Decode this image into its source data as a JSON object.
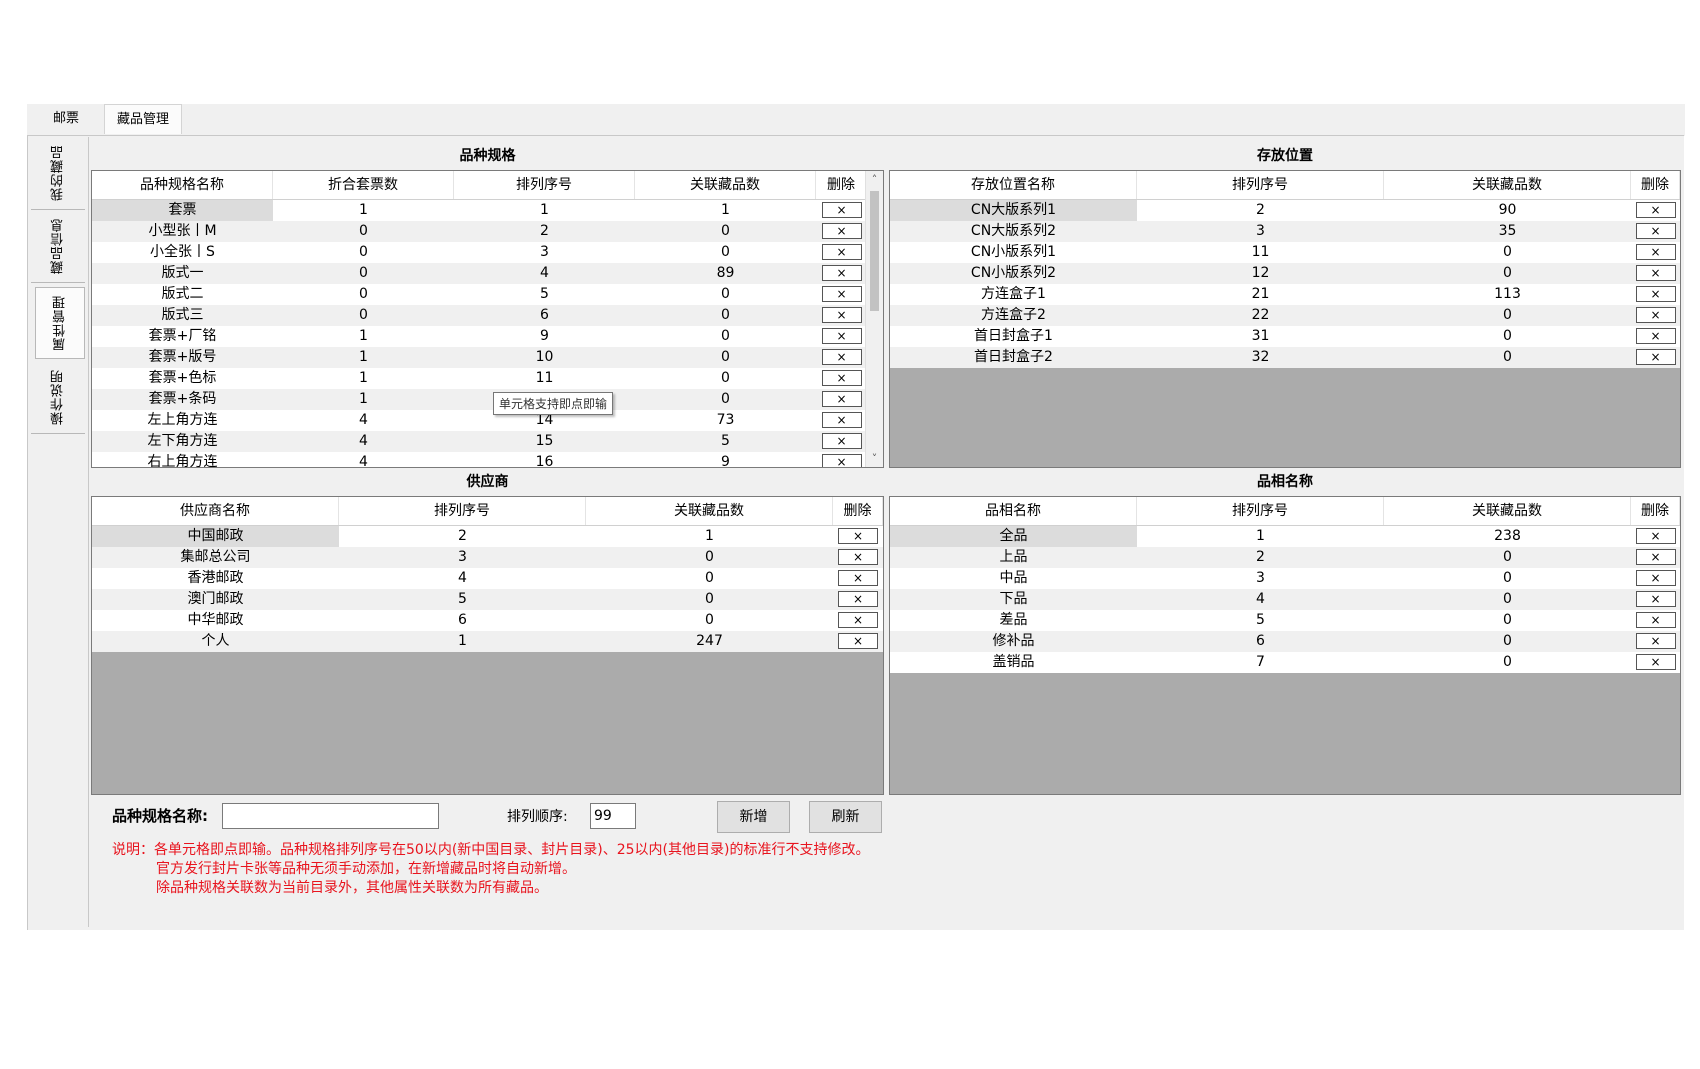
{
  "top_tabs": [
    {
      "label": "邮票"
    },
    {
      "label": "藏品管理"
    }
  ],
  "side_tabs": [
    {
      "label": "我的藏品"
    },
    {
      "label": "藏品信息"
    },
    {
      "label": "属性管理"
    },
    {
      "label": "操作说明"
    }
  ],
  "variety": {
    "title": "品种规格",
    "headers": [
      "品种规格名称",
      "折合套票数",
      "排列序号",
      "关联藏品数",
      "删除"
    ],
    "rows": [
      [
        "套票",
        "1",
        "1",
        "1"
      ],
      [
        "小型张丨M",
        "0",
        "2",
        "0"
      ],
      [
        "小全张丨S",
        "0",
        "3",
        "0"
      ],
      [
        "版式一",
        "0",
        "4",
        "89"
      ],
      [
        "版式二",
        "0",
        "5",
        "0"
      ],
      [
        "版式三",
        "0",
        "6",
        "0"
      ],
      [
        "套票+厂铭",
        "1",
        "9",
        "0"
      ],
      [
        "套票+版号",
        "1",
        "10",
        "0"
      ],
      [
        "套票+色标",
        "1",
        "11",
        "0"
      ],
      [
        "套票+条码",
        "1",
        "",
        "0"
      ],
      [
        "左上角方连",
        "4",
        "14",
        "73"
      ],
      [
        "左下角方连",
        "4",
        "15",
        "5"
      ],
      [
        "右上角方连",
        "4",
        "16",
        "9"
      ]
    ],
    "delete_glyph": "×",
    "tooltip": "单元格支持即点即输"
  },
  "storage": {
    "title": "存放位置",
    "headers": [
      "存放位置名称",
      "排列序号",
      "关联藏品数",
      "删除"
    ],
    "rows": [
      [
        "CN大版系列1",
        "2",
        "90"
      ],
      [
        "CN大版系列2",
        "3",
        "35"
      ],
      [
        "CN小版系列1",
        "11",
        "0"
      ],
      [
        "CN小版系列2",
        "12",
        "0"
      ],
      [
        "方连盒子1",
        "21",
        "113"
      ],
      [
        "方连盒子2",
        "22",
        "0"
      ],
      [
        "首日封盒子1",
        "31",
        "0"
      ],
      [
        "首日封盒子2",
        "32",
        "0"
      ]
    ]
  },
  "supplier": {
    "title": "供应商",
    "headers": [
      "供应商名称",
      "排列序号",
      "关联藏品数",
      "删除"
    ],
    "rows": [
      [
        "中国邮政",
        "2",
        "1"
      ],
      [
        "集邮总公司",
        "3",
        "0"
      ],
      [
        "香港邮政",
        "4",
        "0"
      ],
      [
        "澳门邮政",
        "5",
        "0"
      ],
      [
        "中华邮政",
        "6",
        "0"
      ],
      [
        "个人",
        "1",
        "247"
      ]
    ]
  },
  "condition": {
    "title": "品相名称",
    "headers": [
      "品相名称",
      "排列序号",
      "关联藏品数",
      "删除"
    ],
    "rows": [
      [
        "全品",
        "1",
        "238"
      ],
      [
        "上品",
        "2",
        "0"
      ],
      [
        "中品",
        "3",
        "0"
      ],
      [
        "下品",
        "4",
        "0"
      ],
      [
        "差品",
        "5",
        "0"
      ],
      [
        "修补品",
        "6",
        "0"
      ],
      [
        "盖销品",
        "7",
        "0"
      ]
    ]
  },
  "form": {
    "name_label": "品种规格名称:",
    "name_value": "",
    "order_label": "排列顺序:",
    "order_value": "99",
    "add_label": "新增",
    "refresh_label": "刷新"
  },
  "notes": [
    "说明：各单元格即点即输。品种规格排列序号在50以内(新中国目录、封片目录)、25以内(其他目录)的标准行不支持修改。",
    "官方发行封片卡张等品种无须手动添加，在新增藏品时将自动新增。",
    "除品种规格关联数为当前目录外，其他属性关联数为所有藏品。"
  ]
}
